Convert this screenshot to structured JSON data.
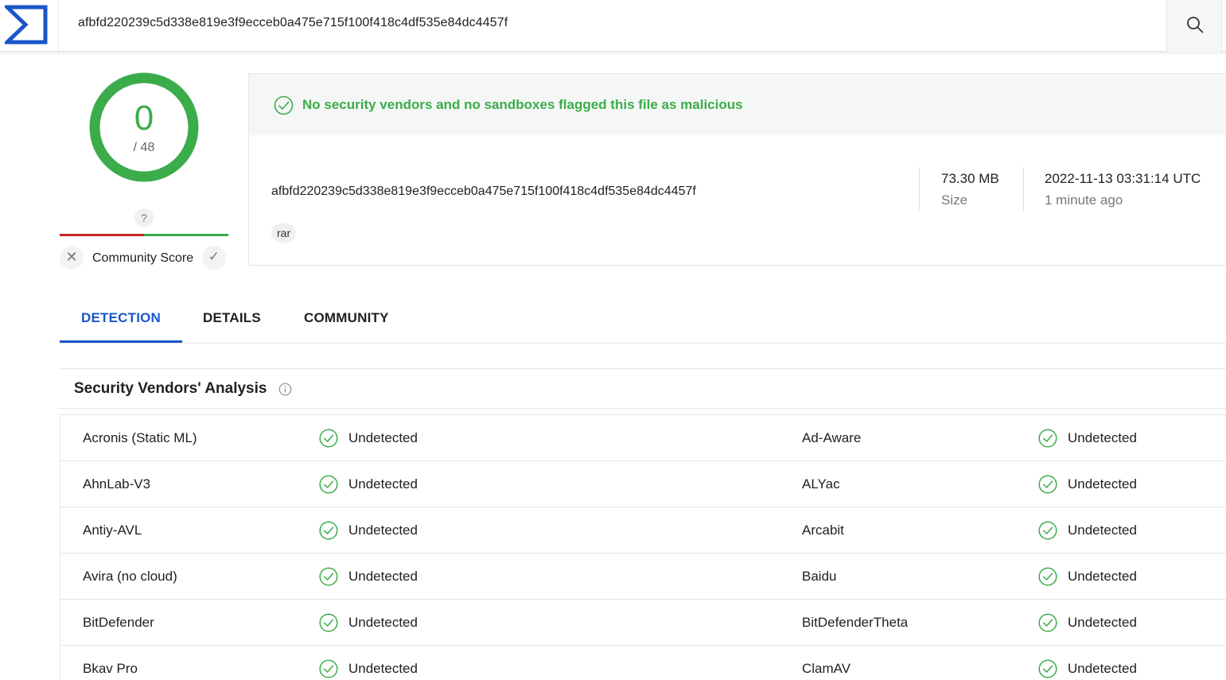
{
  "search": {
    "query": "afbfd220239c5d338e819e3f9ecceb0a475e715f100f418c4df535e84dc4457f"
  },
  "score": {
    "detections": "0",
    "total": "/ 48",
    "community_unknown": "?",
    "community_label": "Community Score"
  },
  "summary": {
    "banner": "No security vendors and no sandboxes flagged this file as malicious",
    "hash": "afbfd220239c5d338e819e3f9ecceb0a475e715f100f418c4df535e84dc4457f",
    "tag": "rar",
    "size_value": "73.30 MB",
    "size_label": "Size",
    "date_value": "2022-11-13 03:31:14 UTC",
    "date_relative": "1 minute ago"
  },
  "tabs": [
    {
      "label": "DETECTION"
    },
    {
      "label": "DETAILS"
    },
    {
      "label": "COMMUNITY"
    }
  ],
  "section": {
    "title": "Security Vendors' Analysis"
  },
  "vendors": [
    {
      "left": {
        "name": "Acronis (Static ML)",
        "status": "Undetected"
      },
      "right": {
        "name": "Ad-Aware",
        "status": "Undetected"
      }
    },
    {
      "left": {
        "name": "AhnLab-V3",
        "status": "Undetected"
      },
      "right": {
        "name": "ALYac",
        "status": "Undetected"
      }
    },
    {
      "left": {
        "name": "Antiy-AVL",
        "status": "Undetected"
      },
      "right": {
        "name": "Arcabit",
        "status": "Undetected"
      }
    },
    {
      "left": {
        "name": "Avira (no cloud)",
        "status": "Undetected"
      },
      "right": {
        "name": "Baidu",
        "status": "Undetected"
      }
    },
    {
      "left": {
        "name": "BitDefender",
        "status": "Undetected"
      },
      "right": {
        "name": "BitDefenderTheta",
        "status": "Undetected"
      }
    },
    {
      "left": {
        "name": "Bkav Pro",
        "status": "Undetected"
      },
      "right": {
        "name": "ClamAV",
        "status": "Undetected"
      }
    }
  ],
  "colors": {
    "accent": "#1a56c9",
    "clean": "#3bac4a",
    "malicious": "#c62828"
  }
}
